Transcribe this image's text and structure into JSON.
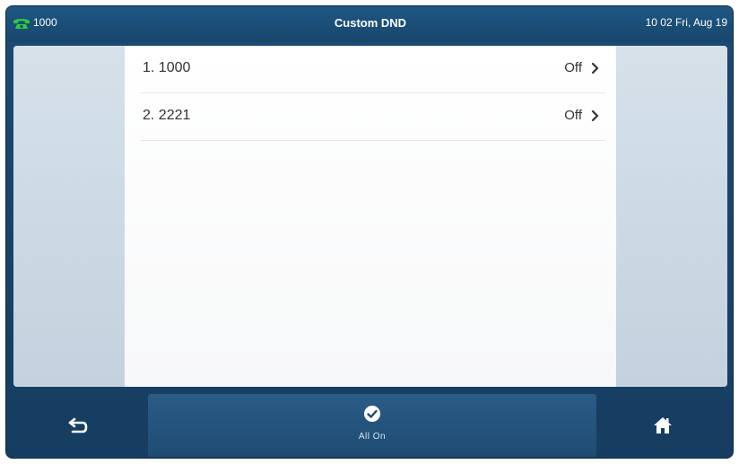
{
  "status_bar": {
    "account": "1000",
    "title": "Custom DND",
    "datetime": "10 02 Fri, Aug 19",
    "phone_icon_color": "#2ecc40"
  },
  "list": {
    "items": [
      {
        "label": "1. 1000",
        "value": "Off"
      },
      {
        "label": "2. 2221",
        "value": "Off"
      }
    ]
  },
  "bottom_bar": {
    "back_icon": "back-arrow-icon",
    "softkey_icon": "check-circle-icon",
    "softkey_label": "All On",
    "home_icon": "home-icon"
  }
}
